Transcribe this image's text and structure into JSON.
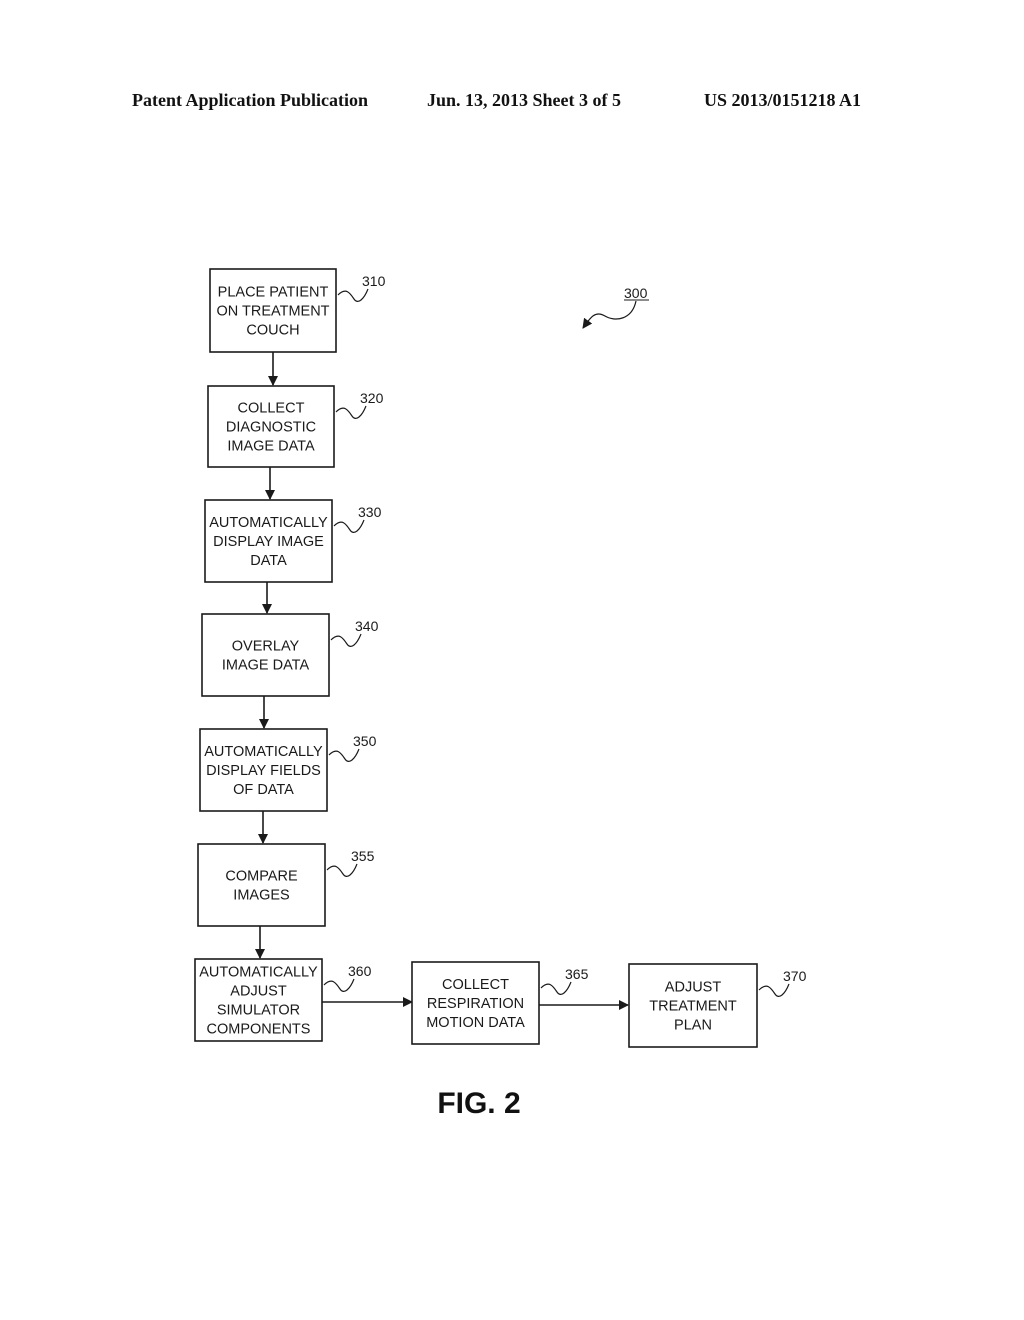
{
  "header": {
    "left": "Patent Application Publication",
    "middle": "Jun. 13, 2013  Sheet 3 of 5",
    "right": "US 2013/0151218 A1"
  },
  "figure": {
    "ref": "300",
    "caption": "FIG. 2"
  },
  "steps": [
    {
      "ref": "310",
      "lines": [
        "PLACE PATIENT",
        "ON TREATMENT",
        "COUCH"
      ]
    },
    {
      "ref": "320",
      "lines": [
        "COLLECT",
        "DIAGNOSTIC",
        "IMAGE DATA"
      ]
    },
    {
      "ref": "330",
      "lines": [
        "AUTOMATICALLY",
        "DISPLAY IMAGE",
        "DATA"
      ]
    },
    {
      "ref": "340",
      "lines": [
        "OVERLAY",
        "IMAGE DATA"
      ]
    },
    {
      "ref": "350",
      "lines": [
        "AUTOMATICALLY",
        "DISPLAY FIELDS",
        "OF DATA"
      ]
    },
    {
      "ref": "355",
      "lines": [
        "COMPARE",
        "IMAGES"
      ]
    },
    {
      "ref": "360",
      "lines": [
        "AUTOMATICALLY",
        "ADJUST",
        "SIMULATOR",
        "COMPONENTS"
      ]
    },
    {
      "ref": "365",
      "lines": [
        "COLLECT",
        "RESPIRATION",
        "MOTION DATA"
      ]
    },
    {
      "ref": "370",
      "lines": [
        "ADJUST",
        "TREATMENT",
        "PLAN"
      ]
    }
  ]
}
